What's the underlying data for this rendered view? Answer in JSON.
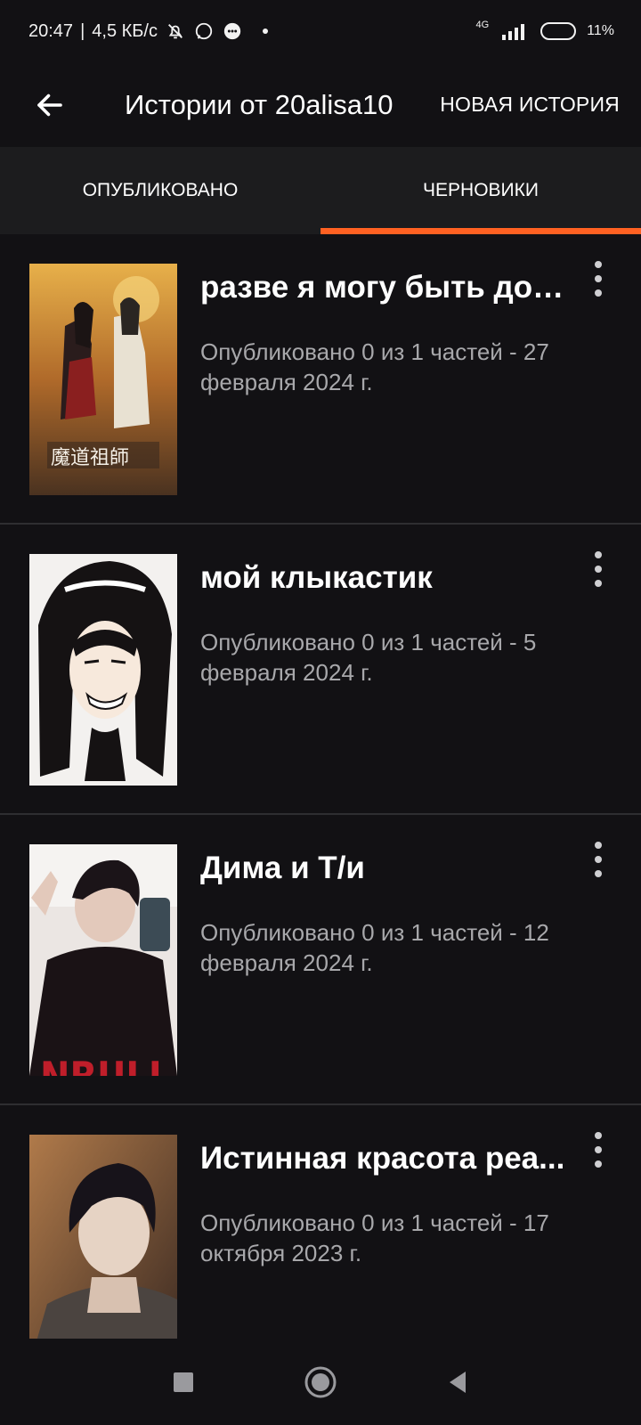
{
  "status_bar": {
    "time": "20:47",
    "speed": "4,5 КБ/с",
    "network": "4G",
    "battery": "11%",
    "battery_level": 0.11,
    "icons": [
      "bell-off-icon",
      "whatsapp-icon",
      "chat-bubble-icon"
    ]
  },
  "app_bar": {
    "title": "Истории от 20alisa10",
    "new_story": "НОВАЯ ИСТОРИЯ"
  },
  "tabs": [
    {
      "label": "ОПУБЛИКОВАНО",
      "active": false
    },
    {
      "label": "ЧЕРНОВИКИ",
      "active": true
    }
  ],
  "accent_color": "#ff6122",
  "stories": [
    {
      "title": "разве я могу быть доб...",
      "meta": "Опубликовано 0 из 1 частей - 27 февраля 2024 г.",
      "cover": "anime-illustration"
    },
    {
      "title": "мой клыкастик",
      "meta": "Опубликовано 0 из 1 частей - 5 февраля 2024 г.",
      "cover": "manga-portrait"
    },
    {
      "title": "Дима и Т/и",
      "meta": "Опубликовано 0 из 1 частей - 12 февраля 2024 г.",
      "cover": "mirror-selfie-photo"
    },
    {
      "title": "Истинная красота реа...",
      "meta": "Опубликовано 0 из 1 частей - 17 октября 2023 г.",
      "cover": "portrait-photo"
    }
  ],
  "nav_bar": {
    "icons": [
      "square-recent-icon",
      "circle-home-icon",
      "triangle-back-icon"
    ]
  }
}
